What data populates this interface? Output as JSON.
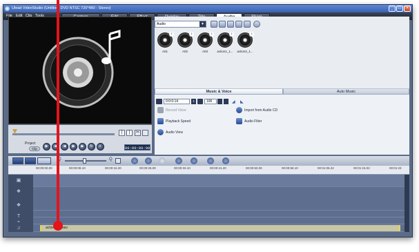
{
  "window": {
    "title": "Ulead VideoStudio (Untitled, DVD NTSC 720*480 - Stereo)",
    "buttons": [
      "_",
      "□",
      "×"
    ]
  },
  "menu": {
    "items": [
      "File",
      "Edit",
      "Clip",
      "Tools"
    ]
  },
  "tabs": [
    "Capture",
    "Edit",
    "Effect",
    "Overlay",
    "Title",
    "Audio",
    "Share"
  ],
  "active_tab": "Audio",
  "preview": {
    "project_label": "Project",
    "clip_label": "Clip",
    "timecode": "00:00:00:00",
    "bracket_in": "[",
    "bracket_out": "]"
  },
  "library": {
    "category": "Audio",
    "clips": [
      "A01",
      "A02",
      "A03",
      "action1_1...",
      "action2_1..."
    ]
  },
  "options_panel": {
    "tabs": [
      "Music & Voice",
      "Auto Music"
    ],
    "duration": "0:0:0:14",
    "volume": "100",
    "record_voice": "Record Voice",
    "import_cd": "Import from Audio CD",
    "playback_speed": "Playback Speed",
    "audio_filter": "Audio Filter",
    "audio_view": "Audio View"
  },
  "timeline": {
    "ticks": [
      "00:00:00.00",
      "00:00:08.10",
      "00:00:16.20",
      "00:00:25.00",
      "00:00:33.10",
      "00:00:41.20",
      "00:00:50.00",
      "00:00:58.10",
      "00:01:06.22",
      "00:01:15.02",
      "00:01:23"
    ],
    "audio_clip": "action1_1.wav",
    "zoom_minus": "Q",
    "zoom_plus": "Q"
  }
}
